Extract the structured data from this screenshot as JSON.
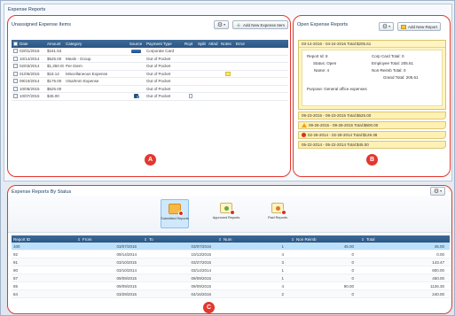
{
  "top_title": "Expense Reports",
  "unassigned": {
    "title": "Unassigned Expense Items",
    "gear_icon": "gear-icon",
    "add_button": "Add New Expense Item",
    "columns": [
      "Date",
      "Amount",
      "Category",
      "Source",
      "Payment Type",
      "Rcpt",
      "Split",
      "Attnd",
      "Notes",
      "Error"
    ],
    "rows": [
      {
        "date": "02/01/2016",
        "amount": "$161.53",
        "category": "",
        "payment": "Corporate Card",
        "source_icon": "card-icon",
        "rcpt": "",
        "notes": ""
      },
      {
        "date": "10/14/2014",
        "amount": "$525.00",
        "category": "Meals - Group",
        "payment": "Out of Pocket",
        "source_icon": "",
        "rcpt": "",
        "notes": ""
      },
      {
        "date": "02/03/2014",
        "amount": "$1,350.00",
        "category": "Per Diem",
        "payment": "Out of Pocket",
        "source_icon": "",
        "rcpt": "",
        "notes": ""
      },
      {
        "date": "01/05/2015",
        "amount": "$18.14",
        "category": "Miscellaneous Expense",
        "payment": "Out of Pocket",
        "source_icon": "",
        "rcpt": "",
        "notes": "note-icon"
      },
      {
        "date": "09/10/2014",
        "amount": "$175.00",
        "category": "Visa/Imm Expense",
        "payment": "Out of Pocket",
        "source_icon": "",
        "rcpt": "",
        "notes": ""
      },
      {
        "date": "10/05/2015",
        "amount": "$625.00",
        "category": "",
        "payment": "Out of Pocket",
        "source_icon": "",
        "rcpt": "",
        "notes": ""
      },
      {
        "date": "10/07/2015",
        "amount": "$45.00",
        "category": "",
        "payment": "Out of Pocket",
        "source_icon": "import-icon",
        "rcpt": "receipt-icon",
        "notes": ""
      }
    ],
    "marker": "A"
  },
  "open_reports": {
    "title": "Open Expense Reports",
    "add_button": "Add New Report",
    "active": {
      "title": "03-14-2016 - 04-24-2016 Total:$205.61",
      "report_id_label": "Report Id:",
      "report_id": "8",
      "status_label": "Status:",
      "status": "Open",
      "name_label": "Name:",
      "name": "4",
      "corp_card_label": "Corp Card Total:",
      "corp_card": "0",
      "employee_total_label": "Employee Total:",
      "employee_total": "205.61",
      "non_reimb_label": "Non-Reimb Total:",
      "non_reimb": "0",
      "grand_total_label": "Grand Total:",
      "grand_total": "205.61",
      "purpose_label": "Purpose:",
      "purpose": "General office expenses"
    },
    "items": [
      {
        "text": "09-23-2015 - 09-23-2015 Total:$625.00",
        "icon": ""
      },
      {
        "text": "09-26-2015 - 09-28-2015 Total:$600.00",
        "icon": "warning-icon"
      },
      {
        "text": "02-26-2014 - 02-28-2014 Total:$129.38",
        "icon": "error-icon"
      },
      {
        "text": "05-22-2014 - 05-22-2014 Total:$45.00",
        "icon": ""
      }
    ],
    "marker": "B"
  },
  "by_status": {
    "title": "Expense Reports By Status",
    "tiles": [
      {
        "label": "Submitted Reports",
        "icon": "folder-icon"
      },
      {
        "label": "Approved Reports",
        "icon": "approved-folder-icon"
      },
      {
        "label": "Paid Reports",
        "icon": "paid-folder-icon"
      }
    ],
    "columns": [
      "Report ID",
      "From",
      "To",
      "Num",
      "Non Reimb",
      "Total"
    ],
    "rows": [
      {
        "id": "100",
        "from": "03/07/2016",
        "to": "03/07/2016",
        "num": "1",
        "nonreimb": "45.00",
        "total": "45.00"
      },
      {
        "id": "92",
        "from": "09/14/2014",
        "to": "10/13/2015",
        "num": "4",
        "nonreimb": "0",
        "total": "0.00"
      },
      {
        "id": "91",
        "from": "03/10/2015",
        "to": "03/27/2015",
        "num": "3",
        "nonreimb": "0",
        "total": "143.47"
      },
      {
        "id": "90",
        "from": "03/10/2014",
        "to": "03/14/2014",
        "num": "1",
        "nonreimb": "0",
        "total": "800.00"
      },
      {
        "id": "87",
        "from": "09/09/2015",
        "to": "09/09/2015",
        "num": "1",
        "nonreimb": "0",
        "total": "450.00"
      },
      {
        "id": "85",
        "from": "09/09/2015",
        "to": "09/09/2015",
        "num": "4",
        "nonreimb": "90.00",
        "total": "1126.30"
      },
      {
        "id": "84",
        "from": "03/29/2016",
        "to": "04/16/2016",
        "num": "2",
        "nonreimb": "0",
        "total": "240.00"
      }
    ],
    "marker": "C"
  }
}
